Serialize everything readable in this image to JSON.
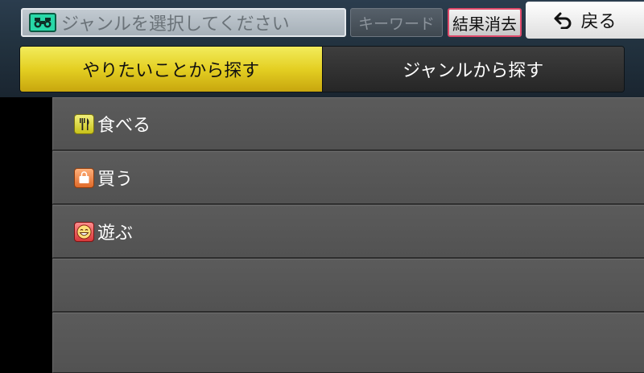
{
  "header": {
    "genre_placeholder": "ジャンルを選択してください",
    "genre_icon": "binoculars-icon",
    "keyword_label": "キーワード",
    "clear_label": "結果消去",
    "back_label": "戻る",
    "back_icon": "return-arrow-icon"
  },
  "tabs": [
    {
      "label": "やりたいことから探す",
      "active": true
    },
    {
      "label": "ジャンルから探す",
      "active": false
    }
  ],
  "list": {
    "items": [
      {
        "label": "食べる",
        "icon": "fork-knife-icon",
        "icon_color": "#e0d830"
      },
      {
        "label": "買う",
        "icon": "shopping-bag-icon",
        "icon_color": "#f08a40"
      },
      {
        "label": "遊ぶ",
        "icon": "smiley-icon",
        "icon_color": "#e84848"
      },
      {
        "label": ""
      },
      {
        "label": ""
      }
    ]
  },
  "colors": {
    "active_tab": "#e4cf22",
    "clear_button_border": "#e04a6a",
    "header_bg": "#22323f",
    "list_row": "#555555"
  }
}
